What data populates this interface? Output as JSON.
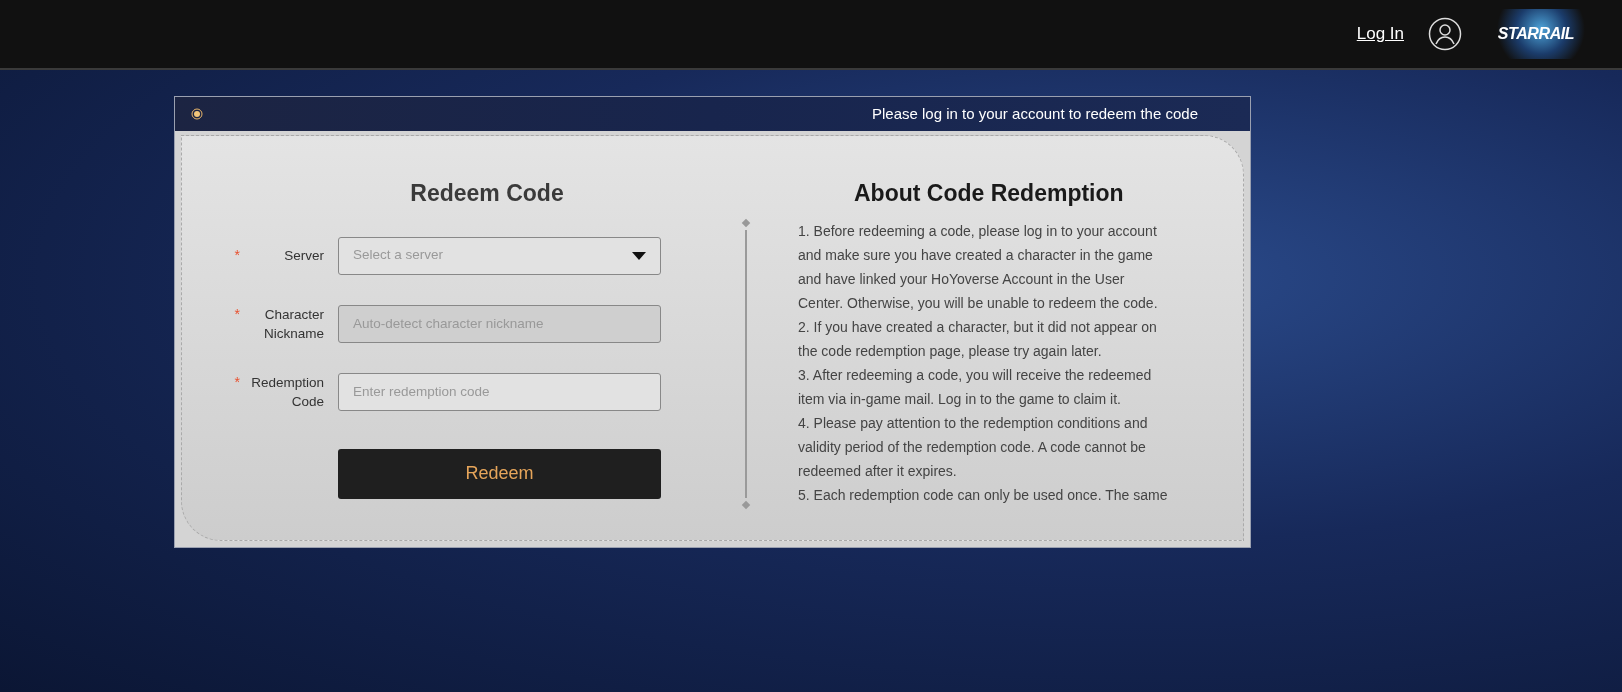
{
  "top_bar": {
    "login_link": "Log In",
    "logo_text": "STARRAIL"
  },
  "card": {
    "header_text": "Please log in to your account to redeem the code",
    "form": {
      "title": "Redeem Code",
      "fields": [
        {
          "kind": "select",
          "label": "Server",
          "required_mark": "*",
          "placeholder": "Select a server",
          "disabled": false
        },
        {
          "kind": "text",
          "label": "Character Nickname",
          "required_mark": "*",
          "placeholder": "Auto-detect character nickname",
          "disabled": true
        },
        {
          "kind": "text",
          "label": "Redemption Code",
          "required_mark": "*",
          "placeholder": "Enter redemption code",
          "disabled": false
        }
      ],
      "submit_button": "Redeem"
    },
    "about": {
      "title": "About Code Redemption",
      "paragraphs": [
        "1. Before redeeming a code, please log in to your account and make sure you have created a character in the game and have linked your HoYoverse Account in the User Center. Otherwise, you will be unable to redeem the code.",
        "2. If you have created a character, but it did not appear on the code redemption page, please try again later.",
        "3. After redeeming a code, you will receive the redeemed item via in-game mail. Log in to the game to claim it.",
        "4. Please pay attention to the redemption conditions and validity period of the redemption code. A code cannot be redeemed after it expires.",
        "5. Each redemption code can only be used once. The same"
      ]
    }
  }
}
